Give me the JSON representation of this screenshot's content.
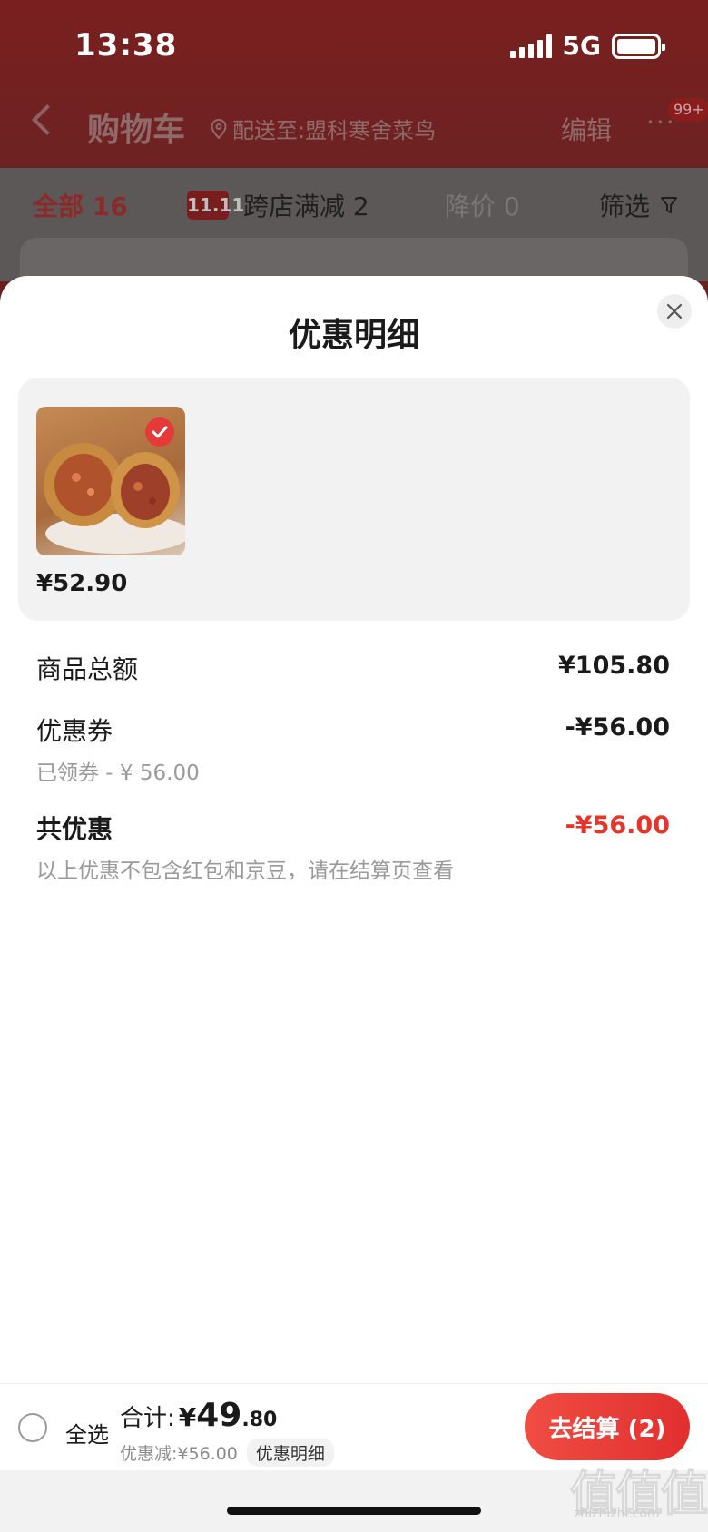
{
  "status_bar": {
    "time": "13:38",
    "network": "5G"
  },
  "nav": {
    "title": "购物车",
    "location": "配送至:盟科寒舍菜鸟",
    "edit": "编辑",
    "more": "···",
    "badge": "99+"
  },
  "tabs": {
    "all": "全部 16",
    "cross_store_logo": "11.11",
    "cross_store": "跨店满减 2",
    "price_drop": "降价 0",
    "filter": "筛选"
  },
  "modal": {
    "title": "优惠明细",
    "product_price": "¥52.90",
    "rows": {
      "goods_total_label": "商品总额",
      "goods_total_value": "¥105.80",
      "coupon_label": "优惠券",
      "coupon_value": "-¥56.00",
      "coupon_note": "已领券 - ¥ 56.00",
      "total_discount_label": "共优惠",
      "total_discount_value": "-¥56.00",
      "total_note": "以上优惠不包含红包和京豆，请在结算页查看"
    }
  },
  "bottom_bar": {
    "select_all": "全选",
    "sum_label": "合计:",
    "sum_yen": "¥",
    "sum_int": "49",
    "sum_dec": ".80",
    "discount_text": "优惠减:¥56.00",
    "discount_detail": "优惠明细",
    "checkout": "去结算 (2)"
  },
  "watermark": {
    "text": "值值值",
    "url": "zhizhizhi.com"
  },
  "colors": {
    "accent_red": "#e5352b",
    "checkout_red": "#e12f2f"
  }
}
